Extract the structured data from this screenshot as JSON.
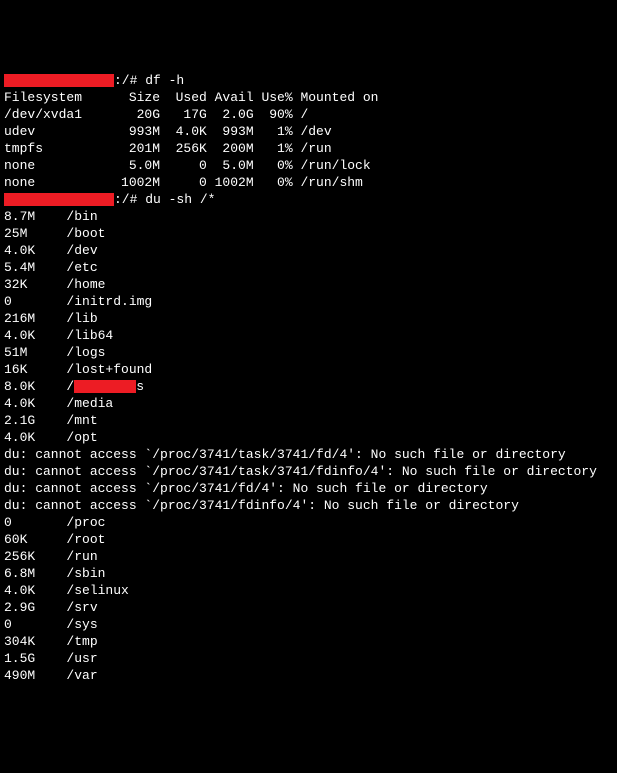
{
  "prompt1_suffix": ":/# ",
  "cmd1": "df -h",
  "df_header": "Filesystem      Size  Used Avail Use% Mounted on",
  "df_rows": [
    "/dev/xvda1       20G   17G  2.0G  90% /",
    "udev            993M  4.0K  993M   1% /dev",
    "tmpfs           201M  256K  200M   1% /run",
    "none            5.0M     0  5.0M   0% /run/lock",
    "none           1002M     0 1002M   0% /run/shm"
  ],
  "prompt2_suffix": ":/# ",
  "cmd2": "du -sh /*",
  "du_rows": [
    {
      "size": "8.7M",
      "path": "/bin",
      "redacted": false
    },
    {
      "size": "25M",
      "path": "/boot",
      "redacted": false
    },
    {
      "size": "4.0K",
      "path": "/dev",
      "redacted": false
    },
    {
      "size": "5.4M",
      "path": "/etc",
      "redacted": false
    },
    {
      "size": "32K",
      "path": "/home",
      "redacted": false
    },
    {
      "size": "0",
      "path": "/initrd.img",
      "redacted": false
    },
    {
      "size": "216M",
      "path": "/lib",
      "redacted": false
    },
    {
      "size": "4.0K",
      "path": "/lib64",
      "redacted": false
    },
    {
      "size": "51M",
      "path": "/logs",
      "redacted": false
    },
    {
      "size": "16K",
      "path": "/lost+found",
      "redacted": false
    },
    {
      "size": "8.0K",
      "path": "/",
      "redacted": true,
      "suffix": "s"
    },
    {
      "size": "4.0K",
      "path": "/media",
      "redacted": false
    },
    {
      "size": "2.1G",
      "path": "/mnt",
      "redacted": false
    },
    {
      "size": "4.0K",
      "path": "/opt",
      "redacted": false
    }
  ],
  "du_errors": [
    "du: cannot access `/proc/3741/task/3741/fd/4': No such file or directory",
    "du: cannot access `/proc/3741/task/3741/fdinfo/4': No such file or directory",
    "du: cannot access `/proc/3741/fd/4': No such file or directory",
    "du: cannot access `/proc/3741/fdinfo/4': No such file or directory"
  ],
  "du_rows2": [
    {
      "size": "0",
      "path": "/proc"
    },
    {
      "size": "60K",
      "path": "/root"
    },
    {
      "size": "256K",
      "path": "/run"
    },
    {
      "size": "6.8M",
      "path": "/sbin"
    },
    {
      "size": "4.0K",
      "path": "/selinux"
    },
    {
      "size": "2.9G",
      "path": "/srv"
    },
    {
      "size": "0",
      "path": "/sys"
    },
    {
      "size": "304K",
      "path": "/tmp"
    },
    {
      "size": "1.5G",
      "path": "/usr"
    },
    {
      "size": "490M",
      "path": "/var"
    }
  ]
}
